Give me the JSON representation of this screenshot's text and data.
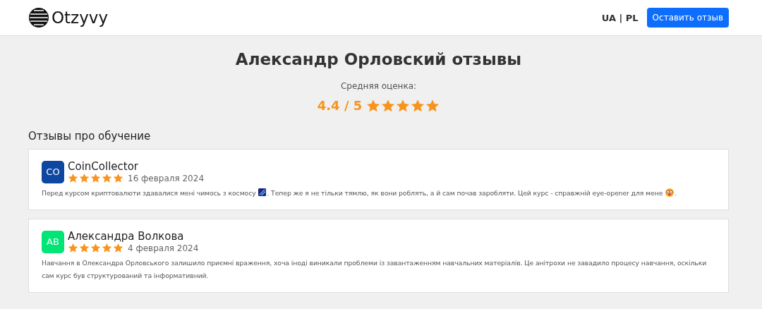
{
  "header": {
    "logo": "Otzyvy",
    "languages": "UA | PL",
    "action": "Оставить отзыв"
  },
  "title": "Александр Орловский отзывы",
  "rating": {
    "label": "Средняя оценка:",
    "score": "4.4 / 5",
    "stars": 5
  },
  "section_title": "Отзывы про обучение",
  "reviews": [
    {
      "initials": "CO",
      "color": "#0d47a1",
      "name": "CoinCollector",
      "stars": 5,
      "date": "16 февраля 2024",
      "text_parts": [
        {
          "kind": "text",
          "text": "Перед курсом криптовалюти здавалися мені чимось з космосу "
        },
        {
          "kind": "tile-emoji"
        },
        {
          "kind": "text",
          "text": ". Тепер же я не тільки тямлю, як вони роблять, а й сам почав заробляти. Цей курс - справжній eye-opener для мене "
        },
        {
          "kind": "face-emoji"
        },
        {
          "kind": "text",
          "text": "."
        }
      ]
    },
    {
      "initials": "AB",
      "color": "#00e676",
      "name": "Александра Волкова",
      "stars": 5,
      "date": "4 февраля 2024",
      "text_parts": [
        {
          "kind": "text",
          "text": "Навчання в Олександра Орловського залишило приємні враження, хоча іноді виникали проблеми із завантаженням навчальних матеріалів. Це анітрохи не завадило процесу навчання, оскільки сам курс був структурований та інформативний."
        }
      ]
    }
  ]
}
